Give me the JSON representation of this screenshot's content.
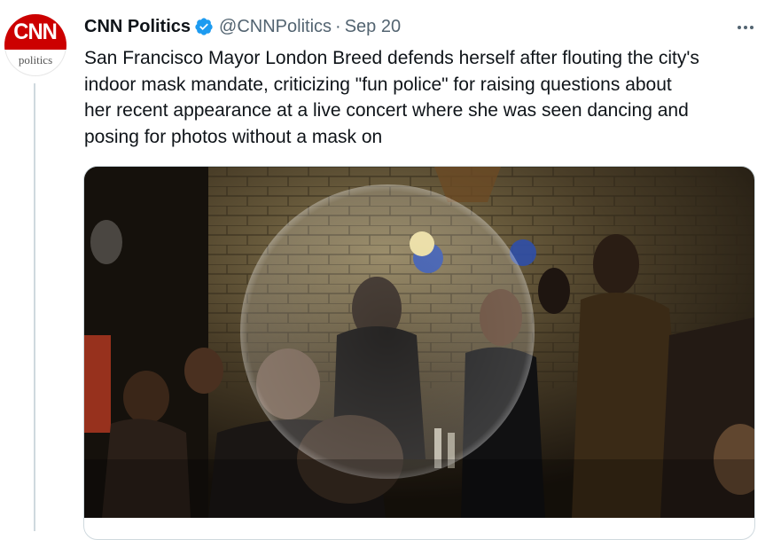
{
  "tweet": {
    "author_name": "CNN Politics",
    "handle": "@CNNPolitics",
    "separator": "·",
    "date": "Sep 20",
    "text": "San Francisco Mayor London Breed defends herself after flouting the city's\nindoor mask mandate, criticizing \"fun police\" for raising questions about\nher recent appearance at a live concert where she was seen dancing and\nposing for photos without a mask on"
  },
  "avatar": {
    "brand": "CNN",
    "subtitle": "politics",
    "brand_color": "#cc0000"
  },
  "icons": {
    "verified": "verified-badge-icon",
    "more": "more-horizontal-icon"
  },
  "colors": {
    "verified": "#1d9bf0",
    "secondary_text": "#536471",
    "border": "#cfd9de"
  }
}
